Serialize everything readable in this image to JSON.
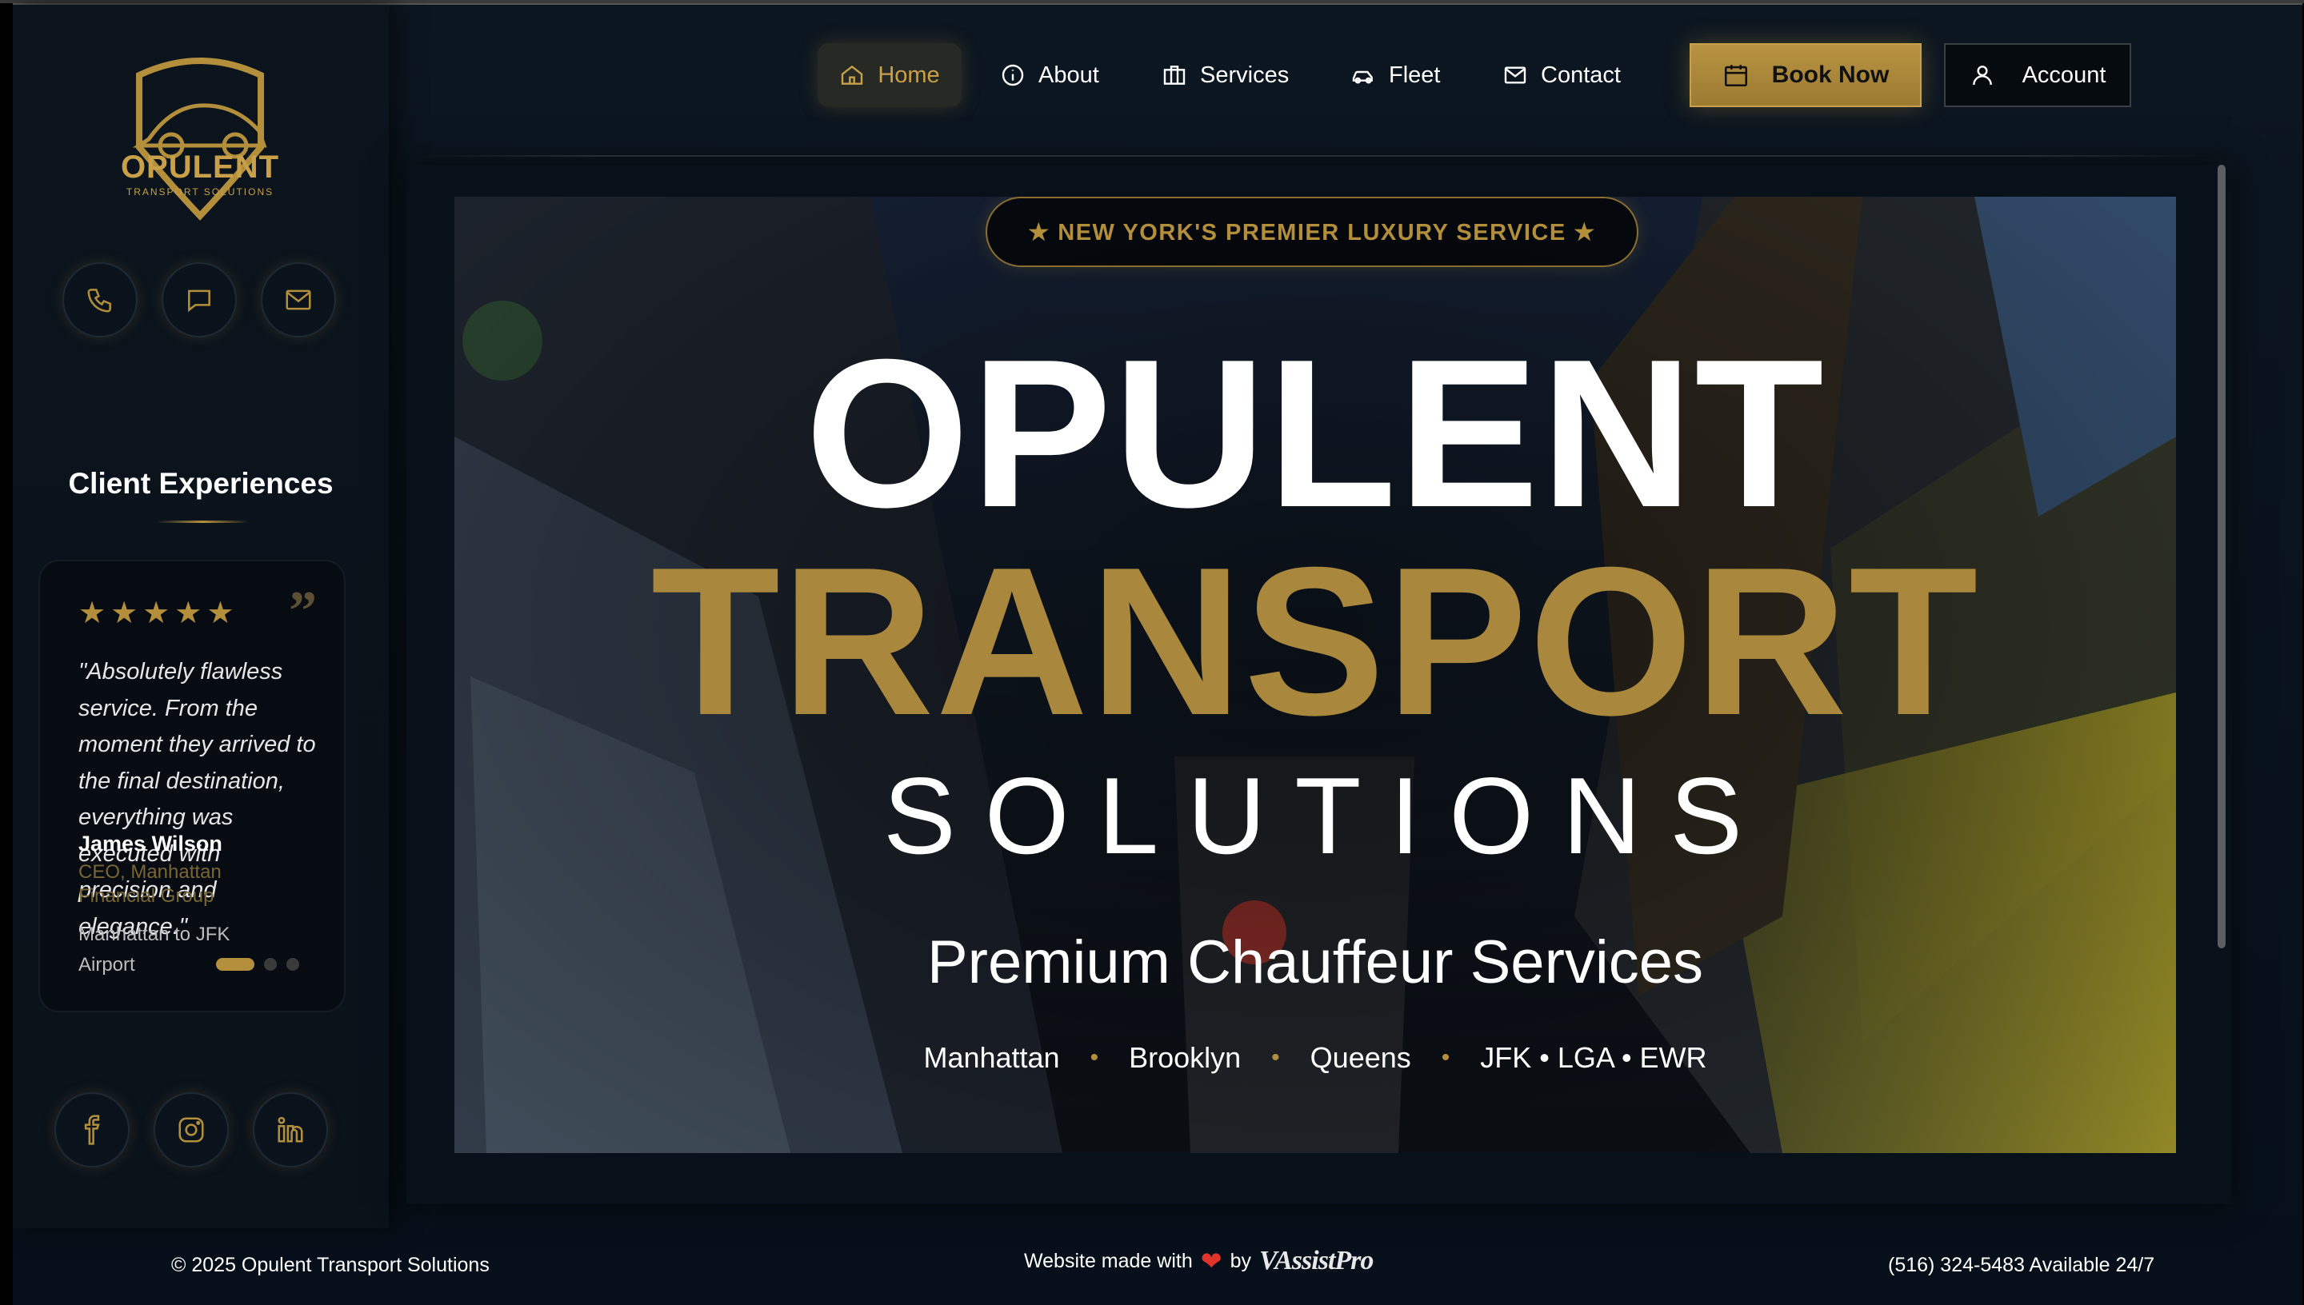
{
  "brand": {
    "logo_main": "OPULENT",
    "logo_sub": "TRANSPORT SOLUTIONS"
  },
  "nav": {
    "items": [
      {
        "label": "Home",
        "icon": "home-icon",
        "active": true
      },
      {
        "label": "About",
        "icon": "info-icon"
      },
      {
        "label": "Services",
        "icon": "briefcase-icon"
      },
      {
        "label": "Fleet",
        "icon": "car-icon"
      },
      {
        "label": "Contact",
        "icon": "mail-icon"
      }
    ],
    "book_label": "Book Now",
    "account_label": "Account"
  },
  "sidebar": {
    "contact_icons": [
      "phone-icon",
      "chat-icon",
      "mail-icon"
    ],
    "testimonials_title": "Client Experiences",
    "testimonial": {
      "rating": 5,
      "quote": "\"Absolutely flawless service. From the moment they arrived to the final destination, everything was executed with precision and elegance.\"",
      "author": "James Wilson",
      "role": "CEO, Manhattan Financial Group",
      "route": "Manhattan to JFK Airport"
    },
    "carousel": {
      "count": 3,
      "active": 0
    },
    "social_icons": [
      "facebook-icon",
      "instagram-icon",
      "linkedin-icon"
    ]
  },
  "hero": {
    "badge": "★ NEW YORK'S PREMIER LUXURY SERVICE ★",
    "title_line1": "OPULENT",
    "title_line2": "TRANSPORT",
    "title_line3": "SOLUTIONS",
    "subtitle": "Premium Chauffeur Services",
    "areas": [
      "Manhattan",
      "Brooklyn",
      "Queens",
      "JFK • LGA • EWR"
    ]
  },
  "footer": {
    "copyright": "© 2025 Opulent Transport Solutions",
    "made_with": "Website made with",
    "by": "by",
    "maker": "VAssistPro",
    "phone": "(516) 324-5483 Available 24/7"
  },
  "colors": {
    "gold": "#b38f3c",
    "background": "#07101a",
    "text": "#ffffff"
  }
}
